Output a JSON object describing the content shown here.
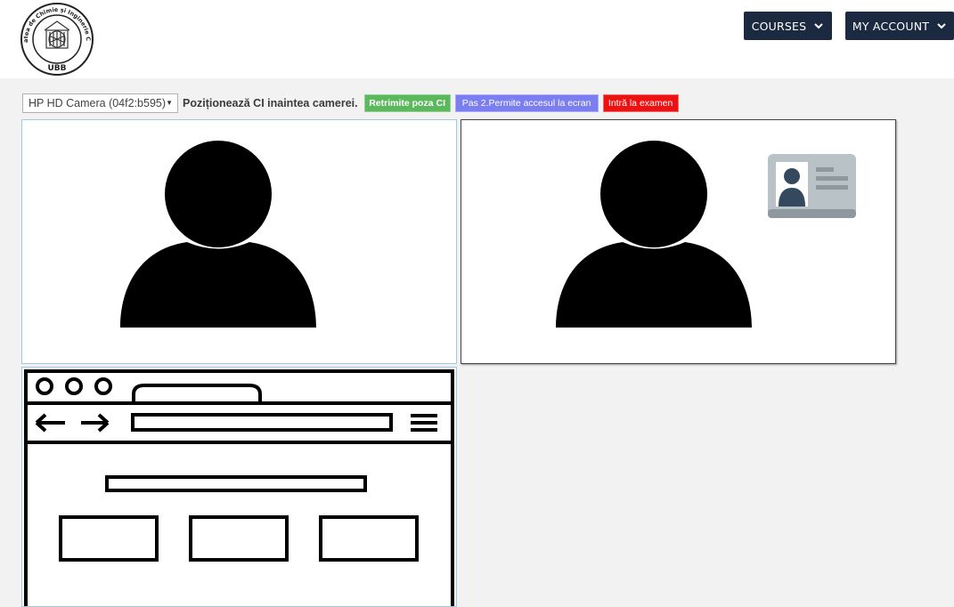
{
  "header": {
    "logo": {
      "text_top": "Facultatea de Chimie și Inginerie Chimică",
      "text_bottom": "UBB"
    },
    "nav": {
      "courses_label": "COURSES",
      "account_label": "MY ACCOUNT",
      "chevron_icon": "chevron-down-icon"
    }
  },
  "toolbar": {
    "camera_select_value": "HP HD Camera (04f2:b595)",
    "instruction": "Poziționează CI inaintea camerei.",
    "resend_photo_label": "Retrimite poza CI",
    "screen_access_label": "Pas 2.Permite accesul la ecran",
    "enter_exam_label": "Intră la examen"
  },
  "panels": {
    "camera": {
      "icon": "user-silhouette-icon"
    },
    "id_card": {
      "icon": "user-silhouette-icon",
      "badge_icon": "id-card-icon"
    },
    "screen_share": {
      "icon": "browser-wireframe-icon"
    }
  },
  "colors": {
    "nav_bg": "#1b2a41",
    "resend": "#5cb85c",
    "screen": "#7a7ef0",
    "exam": "#ee1111"
  }
}
